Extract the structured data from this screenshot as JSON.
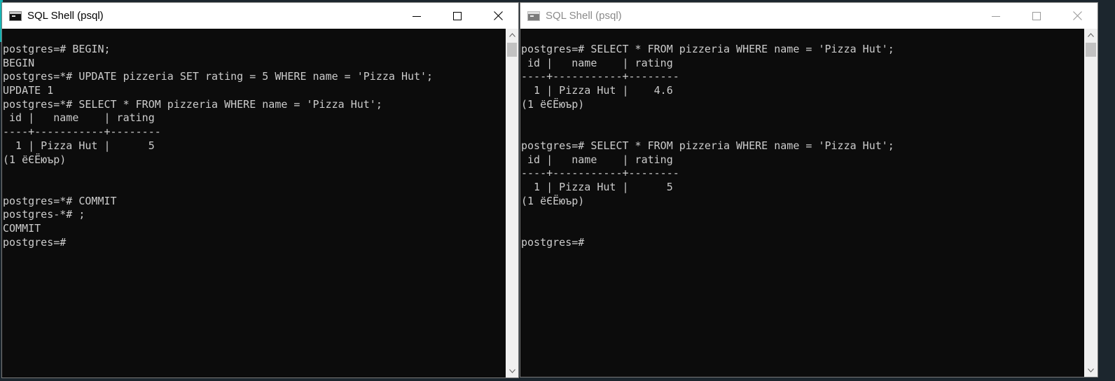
{
  "windows": {
    "left": {
      "title": "SQL Shell (psql)",
      "lines": [
        "postgres=# BEGIN;",
        "BEGIN",
        "postgres=*# UPDATE pizzeria SET rating = 5 WHERE name = 'Pizza Hut';",
        "UPDATE 1",
        "postgres=*# SELECT * FROM pizzeria WHERE name = 'Pizza Hut';",
        " id |   name    | rating",
        "----+-----------+--------",
        "  1 | Pizza Hut |      5",
        "(1 ёЄЁюър)",
        "",
        "",
        "postgres=*# COMMIT",
        "postgres-*# ;",
        "COMMIT",
        "postgres=#"
      ]
    },
    "right": {
      "title": "SQL Shell (psql)",
      "lines": [
        "postgres=# SELECT * FROM pizzeria WHERE name = 'Pizza Hut';",
        " id |   name    | rating",
        "----+-----------+--------",
        "  1 | Pizza Hut |    4.6",
        "(1 ёЄЁюър)",
        "",
        "",
        "postgres=# SELECT * FROM pizzeria WHERE name = 'Pizza Hut';",
        " id |   name    | rating",
        "----+-----------+--------",
        "  1 | Pizza Hut |      5",
        "(1 ёЄЁюър)",
        "",
        "",
        "postgres=#"
      ]
    }
  },
  "icons": {
    "app": "console-app-icon",
    "minimize": "minimize-icon",
    "maximize": "maximize-icon",
    "close": "close-icon",
    "scroll_up": "chevron-up-icon",
    "scroll_down": "chevron-down-icon"
  },
  "colors": {
    "console_bg": "#0c0c0c",
    "console_fg": "#cccccc",
    "titlebar_bg": "#ffffff",
    "inactive_title": "#8a8a8a",
    "desktop_accent": "#14b3b3"
  }
}
